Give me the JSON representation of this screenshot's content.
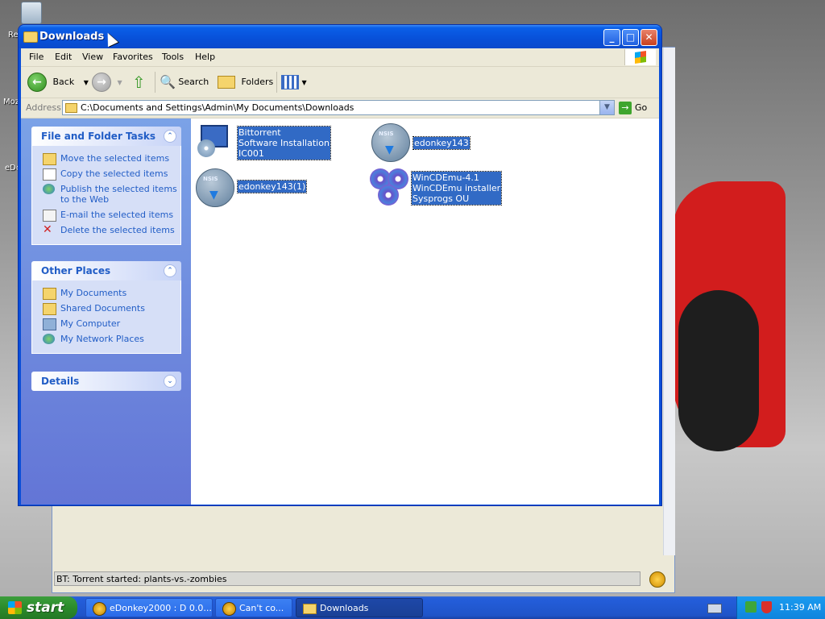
{
  "desktop": {
    "labels": [
      "Re",
      "Moz",
      "eDo"
    ]
  },
  "background_window": {
    "status_text": "BT: Torrent started: plants-vs.-zombies"
  },
  "window": {
    "title": "Downloads",
    "controls": {
      "minimize": "_",
      "maximize": "□",
      "close": "✕"
    },
    "menu": [
      "File",
      "Edit",
      "View",
      "Favorites",
      "Tools",
      "Help"
    ],
    "toolbar": {
      "back": "Back",
      "search": "Search",
      "folders": "Folders"
    },
    "address": {
      "label": "Address",
      "value": "C:\\Documents and Settings\\Admin\\My Documents\\Downloads",
      "go": "Go"
    }
  },
  "task_pane": {
    "file_tasks": {
      "title": "File and Folder Tasks",
      "items": [
        "Move the selected items",
        "Copy the selected items",
        "Publish the selected items to the Web",
        "E-mail the selected items",
        "Delete the selected items"
      ]
    },
    "other_places": {
      "title": "Other Places",
      "items": [
        "My Documents",
        "Shared Documents",
        "My Computer",
        "My Network Places"
      ]
    },
    "details": {
      "title": "Details"
    }
  },
  "files": [
    {
      "name": "Bittorrent",
      "line2": "Software Installation",
      "line3": "IC001"
    },
    {
      "name": "edonkey143"
    },
    {
      "name": "edonkey143(1)"
    },
    {
      "name": "WinCDEmu-4.1",
      "line2": "WinCDEmu installer",
      "line3": "Sysprogs OU"
    }
  ],
  "icons": {
    "nsis_text": "NSIS"
  },
  "taskbar": {
    "start": "start",
    "tasks": [
      "eDonkey2000 : D 0.0...",
      "Can't co...",
      "Downloads"
    ],
    "clock": "11:39 AM"
  }
}
